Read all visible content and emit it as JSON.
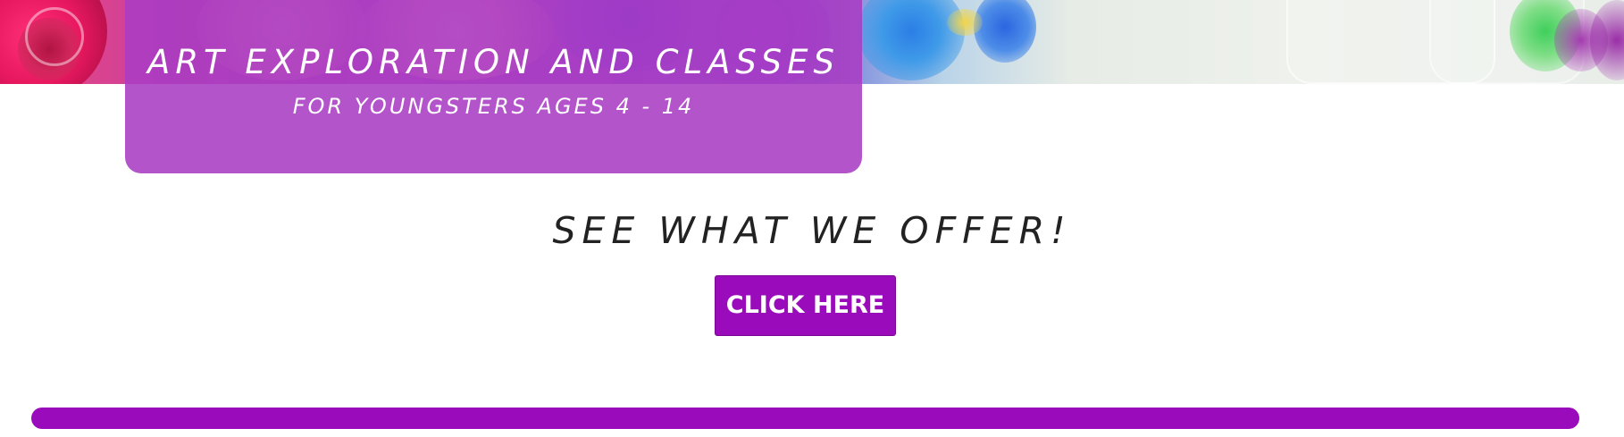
{
  "hero": {
    "title": "ART EXPLORATION AND CLASSES",
    "subtitle": "FOR YOUNGSTERS AGES 4 - 14"
  },
  "offer": {
    "heading": "SEE WHAT WE OFFER!",
    "button_label": "CLICK HERE"
  },
  "colors": {
    "accent": "#9a0cbb",
    "panel": "#aa3cc3",
    "heading_text": "#222222"
  }
}
